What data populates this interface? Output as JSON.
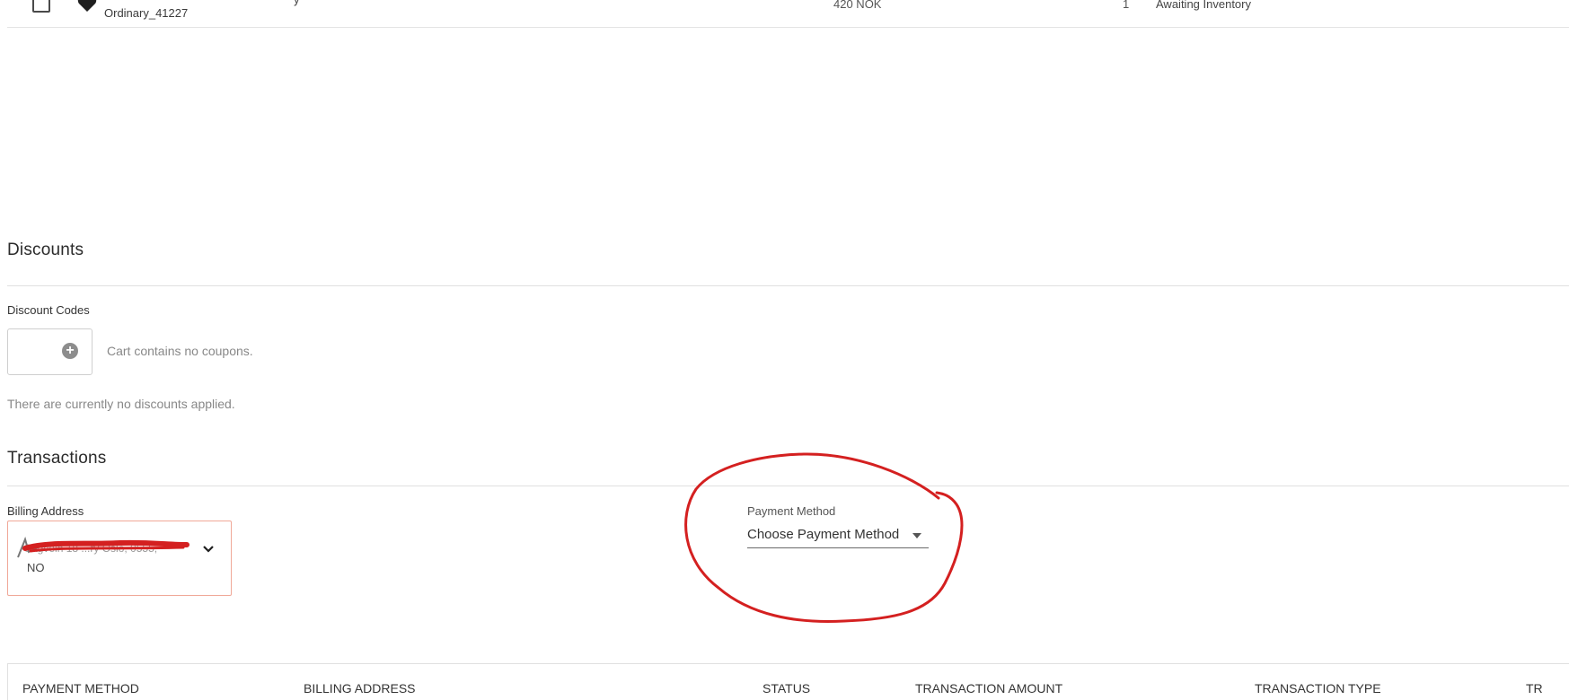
{
  "order_row": {
    "sku": "Ordinary_41227",
    "title_fragment": "y",
    "price": "420 NOK",
    "quantity": "1",
    "status": "Awaiting Inventory"
  },
  "discounts": {
    "title": "Discounts",
    "codes_label": "Discount Codes",
    "no_coupons_text": "Cart contains no coupons.",
    "no_discounts_text": "There are currently no discounts applied."
  },
  "transactions": {
    "title": "Transactions",
    "billing_label": "Billing Address",
    "billing_line1": "Sagvein 18 ...ry Oslo, 0555,",
    "billing_country": "NO",
    "payment_label": "Payment Method",
    "payment_placeholder": "Choose Payment Method"
  },
  "table": {
    "headers": [
      "PAYMENT METHOD",
      "BILLING ADDRESS",
      "STATUS",
      "TRANSACTION AMOUNT",
      "TRANSACTION TYPE",
      "TR"
    ]
  },
  "colors": {
    "annotation": "#d42020",
    "billing_border": "#f0a898"
  },
  "icons": {
    "checkbox": "checkbox-icon",
    "heart": "heart-icon",
    "add": "plus-circle-icon",
    "chevron": "chevron-down-icon",
    "dropdown": "caret-down-icon"
  }
}
